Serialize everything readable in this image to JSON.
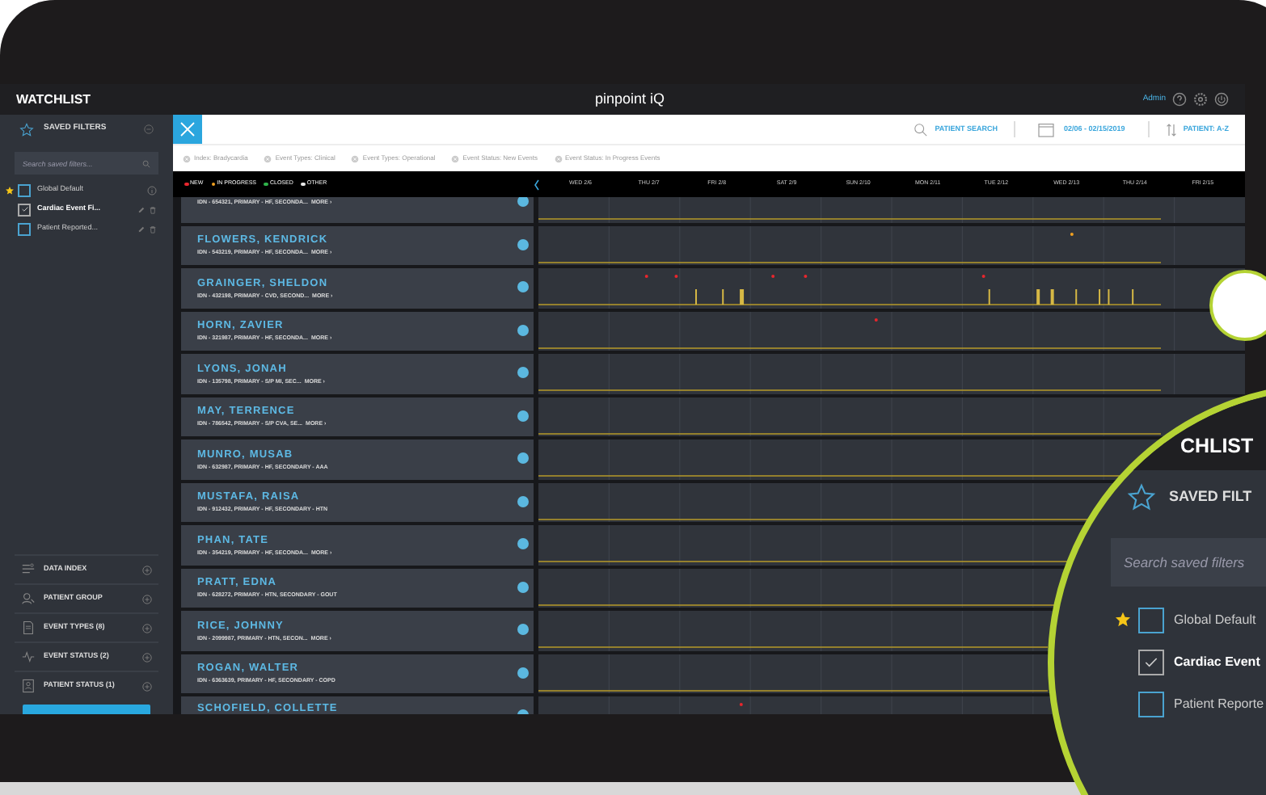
{
  "top_bar": {
    "title": "WATCHLIST",
    "logo": "pinpoint iQ",
    "user": "Admin"
  },
  "sidebar": {
    "section": "SAVED FILTERS",
    "search": {
      "placeholder": "Search saved filters..."
    },
    "filters": [
      {
        "label": "Global Default",
        "kind": "default",
        "starred": true,
        "checked": false
      },
      {
        "label": "Cardiac Event Fi...",
        "kind": "custom",
        "starred": false,
        "checked": true
      },
      {
        "label": "Patient Reported...",
        "kind": "custom",
        "starred": false,
        "checked": false
      }
    ],
    "groups": [
      {
        "label": "DATA INDEX",
        "kind": "index"
      },
      {
        "label": "PATIENT GROUP",
        "kind": "group"
      },
      {
        "label": "EVENT TYPES (8)",
        "kind": "types"
      },
      {
        "label": "EVENT STATUS (2)",
        "kind": "status"
      },
      {
        "label": "PATIENT STATUS (1)",
        "kind": "patient"
      }
    ]
  },
  "header": {
    "search": "PATIENT SEARCH",
    "date_range": "02/06 - 02/15/2019",
    "sort": "PATIENT: A-Z"
  },
  "chips": [
    "Index: Bradycardia",
    "Event Types: Clinical",
    "Event Types: Operational",
    "Event Status: New Events",
    "Event Status: In Progress Events"
  ],
  "legend": [
    {
      "label": "NEW",
      "color": "#e8262d"
    },
    {
      "label": "IN PROGRESS",
      "color": "#f0a020"
    },
    {
      "label": "CLOSED",
      "color": "#2fb34a"
    },
    {
      "label": "OTHER",
      "color": "#e8e8e8"
    }
  ],
  "days": [
    "WED 2/6",
    "THU 2/7",
    "FRI 2/8",
    "SAT 2/9",
    "SUN 2/10",
    "MON 2/11",
    "TUE 2/12",
    "WED 2/13",
    "THU 2/14",
    "FRI 2/15"
  ],
  "patients": [
    {
      "id_line": "IDN - 654321, PRIMARY - HF, SECONDA...",
      "more": "MORE ›"
    },
    {
      "name": "FLOWERS, KENDRICK",
      "id_line": "IDN - 543219, PRIMARY - HF, SECONDA...",
      "more": "MORE ›"
    },
    {
      "name": "GRAINGER, SHELDON",
      "id_line": "IDN - 432198, PRIMARY - CVD, SECOND...",
      "more": "MORE ›"
    },
    {
      "name": "HORN, ZAVIER",
      "id_line": "IDN - 321987, PRIMARY - HF, SECONDA...",
      "more": "MORE ›"
    },
    {
      "name": "LYONS, JONAH",
      "id_line": "IDN - 135798, PRIMARY - S/P MI, SEC...",
      "more": "MORE ›"
    },
    {
      "name": "MAY, TERRENCE",
      "id_line": "IDN - 786542, PRIMARY - S/P CVA, SE...",
      "more": "MORE ›"
    },
    {
      "name": "MUNRO, MUSAB",
      "id_line": "IDN - 632987, PRIMARY - HF, SECONDARY - AAA"
    },
    {
      "name": "MUSTAFA, RAISA",
      "id_line": "IDN - 912432, PRIMARY - HF, SECONDARY - HTN"
    },
    {
      "name": "PHAN, TATE",
      "id_line": "IDN - 354219, PRIMARY - HF, SECONDA...",
      "more": "MORE ›"
    },
    {
      "name": "PRATT, EDNA",
      "id_line": "IDN - 628272, PRIMARY - HTN, SECONDARY - GOUT"
    },
    {
      "name": "RICE, JOHNNY",
      "id_line": "IDN - 2099987, PRIMARY - HTN, SECON...",
      "more": "MORE ›"
    },
    {
      "name": "ROGAN, WALTER",
      "id_line": "IDN - 6363639, PRIMARY - HF, SECONDARY - COPD"
    },
    {
      "name": "SCHOFIELD, COLLETTE"
    }
  ],
  "magnifier": {
    "title": "CHLIST",
    "section": "SAVED FILT",
    "search": {
      "placeholder": "Search saved filters"
    },
    "filters": [
      {
        "label": "Global Default",
        "starred": true,
        "checked": false
      },
      {
        "label": "Cardiac Event",
        "starred": false,
        "checked": true
      },
      {
        "label": "Patient Reporte",
        "starred": false,
        "checked": false
      }
    ]
  }
}
